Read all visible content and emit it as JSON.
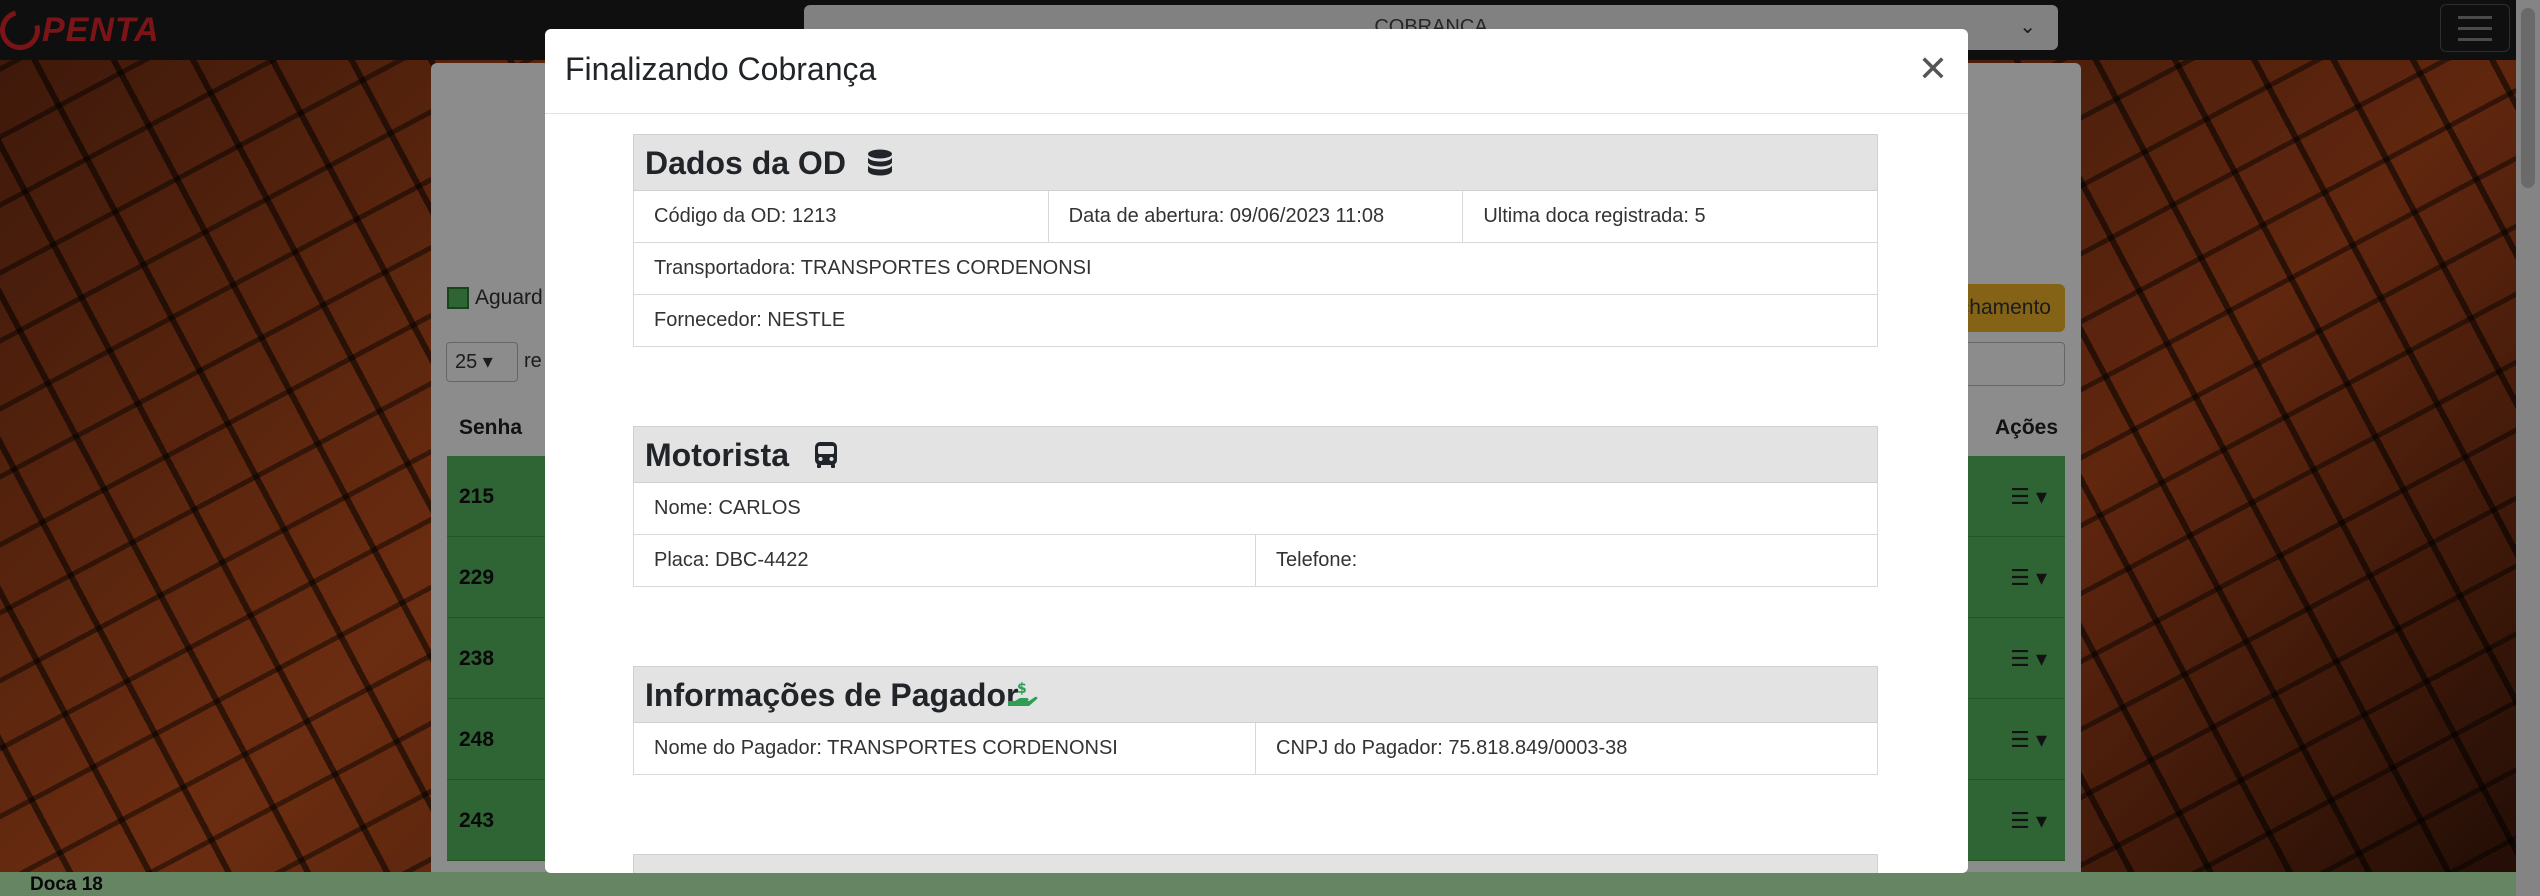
{
  "navbar": {
    "logo_text": "PENTA",
    "context_select": "COBRANÇA",
    "menu_icon": "hamburger-icon"
  },
  "page": {
    "legend_label": "Aguard",
    "page_length": "25",
    "page_length_label": "re",
    "action_button": "chamento",
    "table_headers": {
      "senha": "Senha",
      "acoes": "Ações"
    },
    "rows": [
      {
        "senha": "215"
      },
      {
        "senha": "229"
      },
      {
        "senha": "238"
      },
      {
        "senha": "248"
      },
      {
        "senha": "243"
      }
    ],
    "dock_label": "Doca 18"
  },
  "modal": {
    "title": "Finalizando Cobrança",
    "close_icon": "close-icon",
    "sections": {
      "od": {
        "title": "Dados da OD",
        "icon": "database-icon",
        "codigo": "Código da OD: 1213",
        "abertura": "Data de abertura: 09/06/2023 11:08",
        "ultima_doca": "Ultima doca registrada: 5",
        "transportadora": "Transportadora: TRANSPORTES CORDENONSI",
        "fornecedor": "Fornecedor: NESTLE"
      },
      "motorista": {
        "title": "Motorista",
        "icon": "bus-icon",
        "nome": "Nome: CARLOS",
        "placa": "Placa: DBC-4422",
        "telefone": "Telefone:"
      },
      "pagador": {
        "title": "Informações de Pagador",
        "icon": "hand-money-icon",
        "nome": "Nome do Pagador: TRANSPORTES CORDENONSI",
        "cnpj": "CNPJ do Pagador: 75.818.849/0003-38"
      }
    }
  },
  "colors": {
    "row_green": "#57b65f",
    "accent_yellow": "#f0b52a",
    "icon_green": "#2e9e55",
    "logo_red": "#e0262b"
  }
}
